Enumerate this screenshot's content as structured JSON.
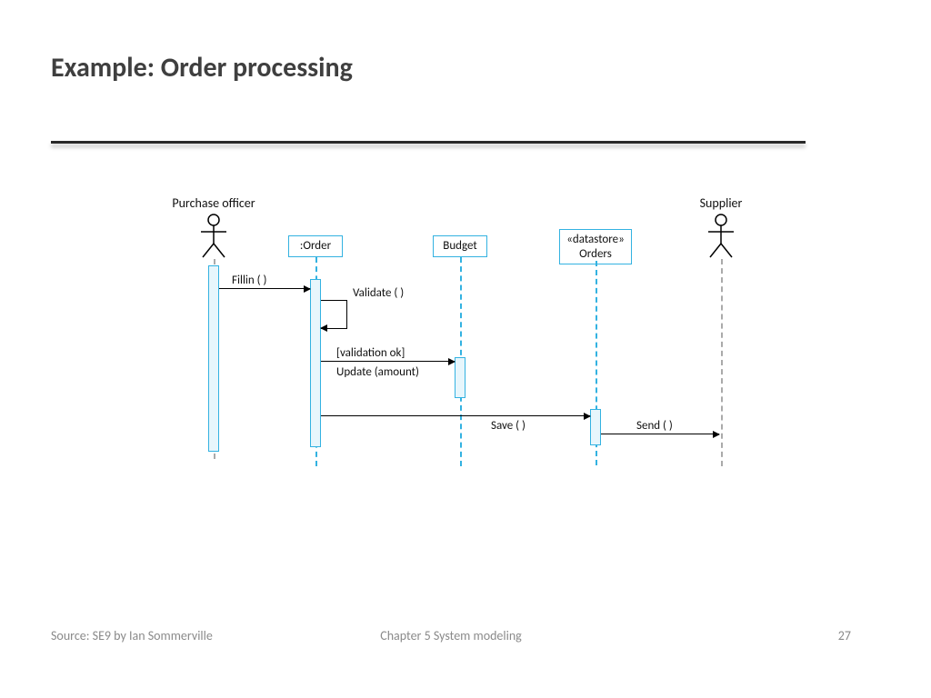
{
  "title": "Example: Order processing",
  "footer": {
    "source": "Source: SE9 by Ian Sommerville",
    "chapter": "Chapter 5 System modeling",
    "page": "27"
  },
  "participants": {
    "purchaseOfficer": "Purchase officer",
    "order": ":Order",
    "budget": "Budget",
    "orders": "«datastore»\nOrders",
    "supplier": "Supplier"
  },
  "messages": {
    "fillin": "Fillin ( )",
    "validate": "Validate ( )",
    "validationOk": "[validation ok]",
    "update": "Update (amount)",
    "save": "Save ( )",
    "send": "Send ( )"
  }
}
